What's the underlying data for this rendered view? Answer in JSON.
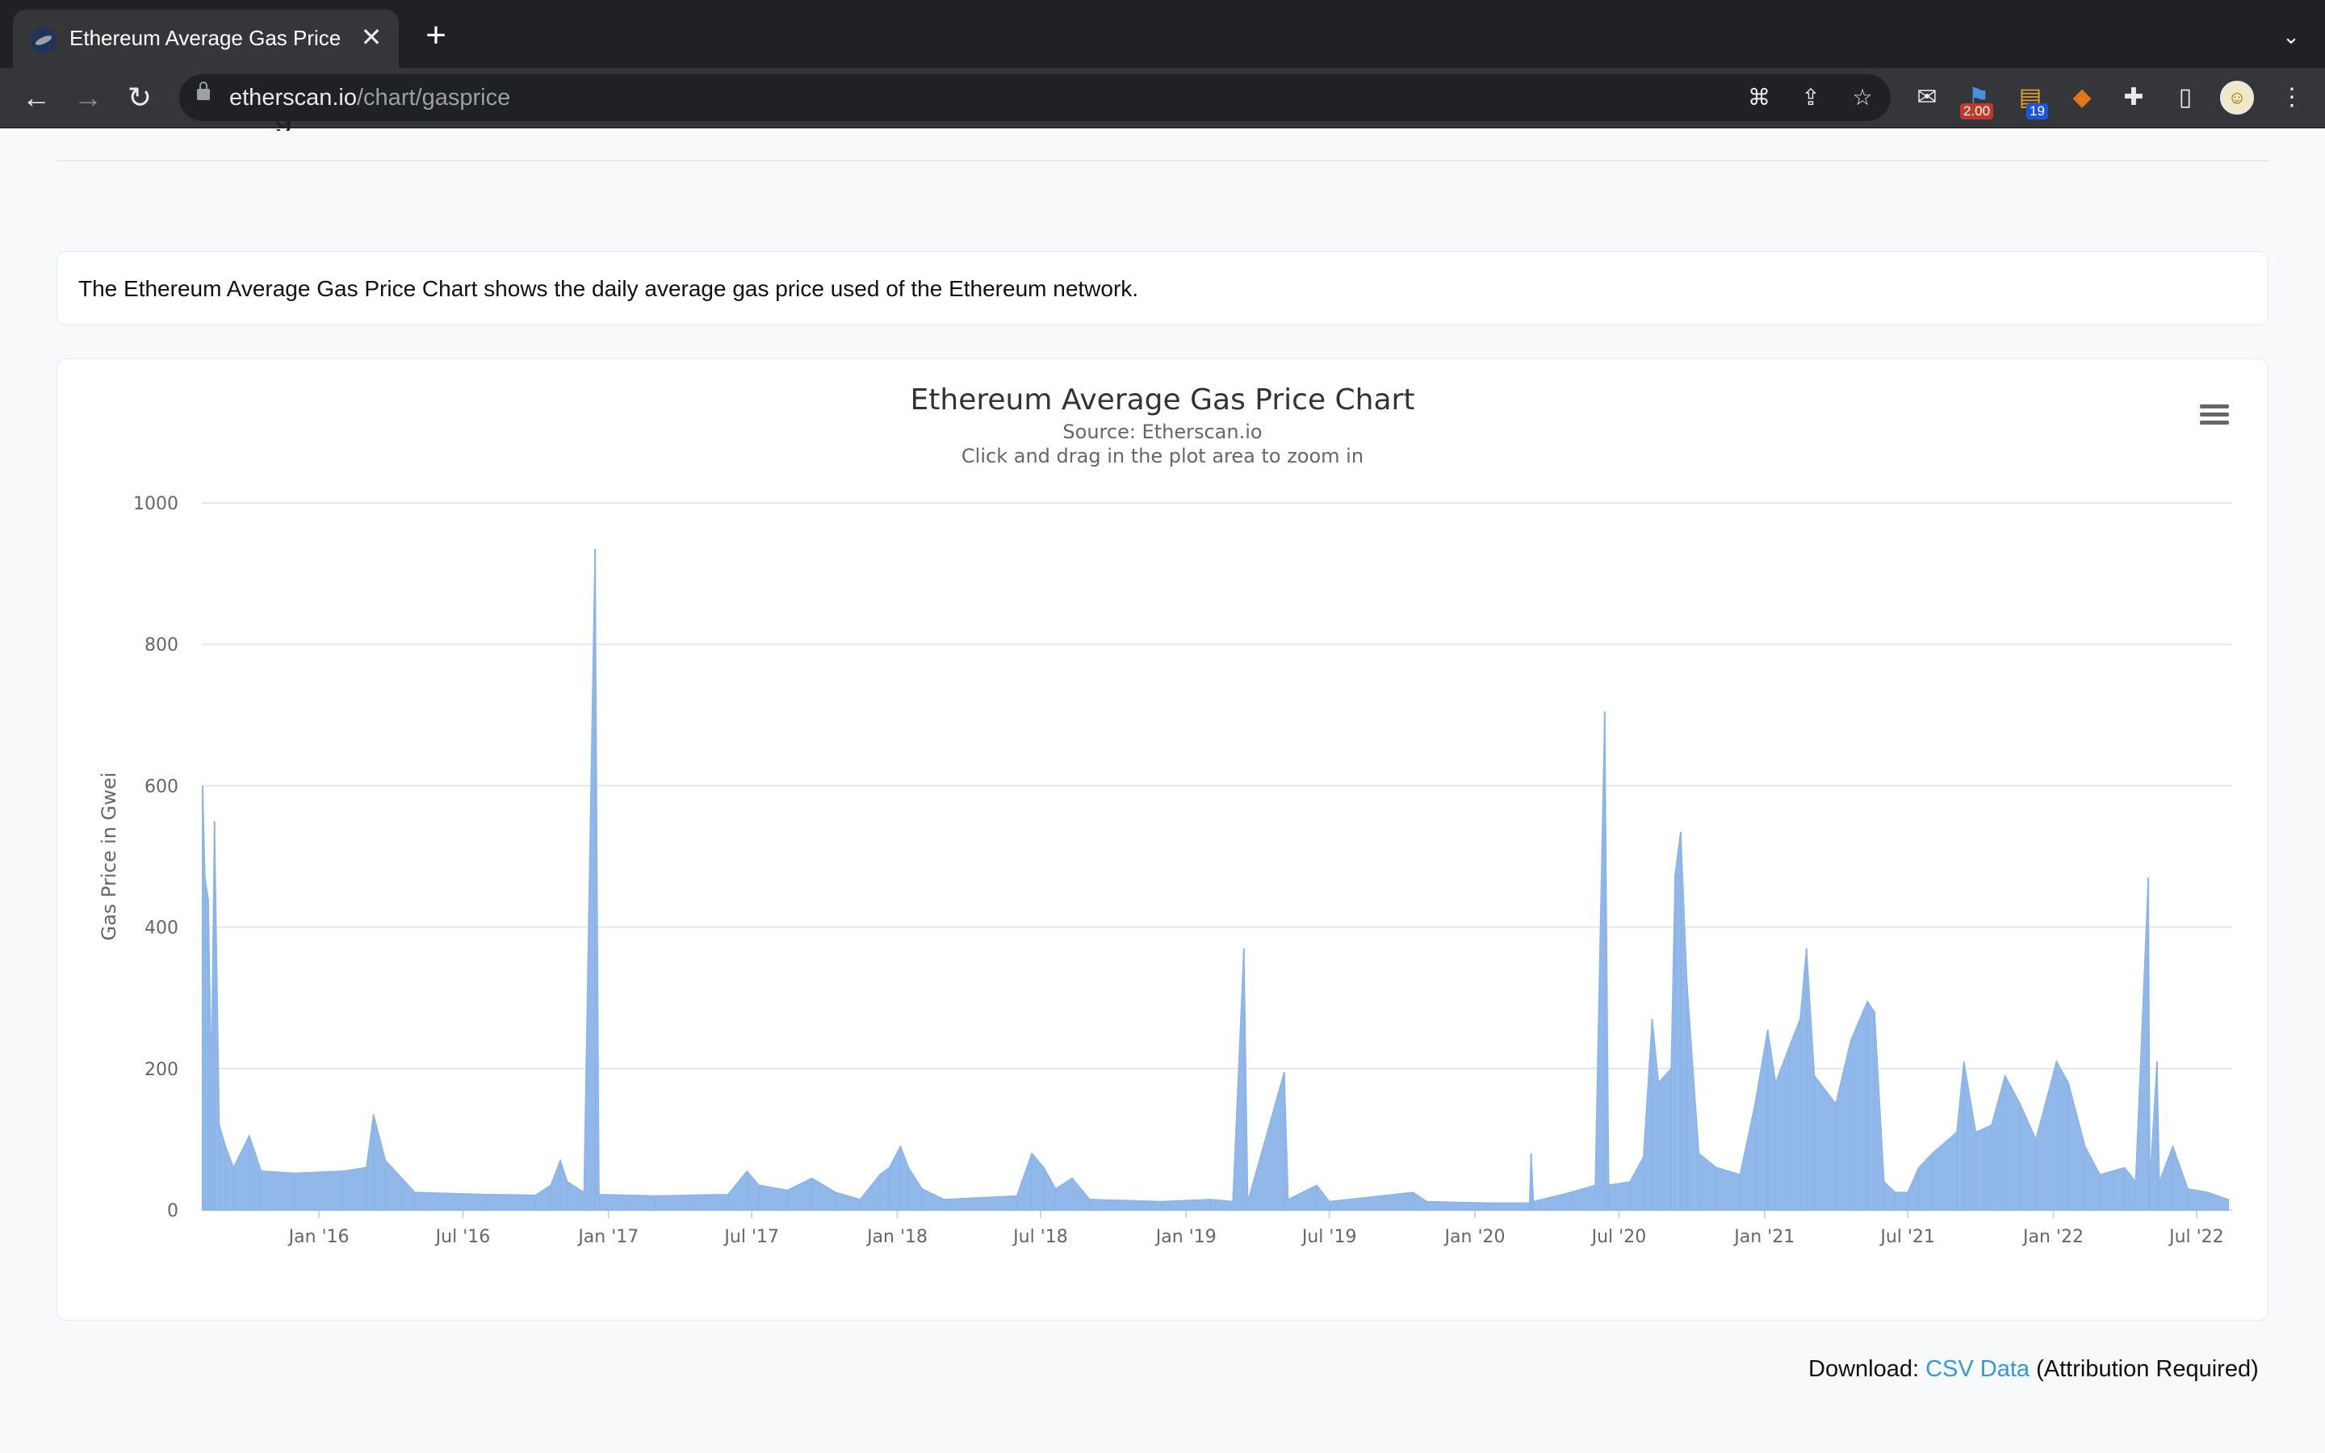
{
  "browser": {
    "tab_title": "Ethereum Average Gas Price Chart | Etherscan",
    "new_tab": "+",
    "url_domain": "etherscan.io",
    "url_path": "/chart/gasprice",
    "extensions": [
      {
        "name": "mail-extension-icon",
        "badge": ""
      },
      {
        "name": "flag-extension-icon",
        "badge": "2.00",
        "badge_color": "#c0392b"
      },
      {
        "name": "rss-extension-icon",
        "badge": "19",
        "badge_color": "#1a56db"
      },
      {
        "name": "fox-wallet-extension-icon",
        "badge": ""
      }
    ]
  },
  "page": {
    "description": "The Ethereum Average Gas Price Chart shows the daily average gas price used of the Ethereum network.",
    "download_prefix": "Download: ",
    "download_link": "CSV Data",
    "download_suffix": " (Attribution Required)"
  },
  "chart_data": {
    "type": "area",
    "title": "Ethereum Average Gas Price Chart",
    "subtitle": "Source: Etherscan.io",
    "subtitle2": "Click and drag in the plot area to zoom in",
    "ylabel": "Gas Price in Gwei",
    "xlabel": "",
    "ylim": [
      0,
      1000
    ],
    "yticks": [
      0,
      200,
      400,
      600,
      800,
      1000
    ],
    "xlim": [
      "2015-08-07",
      "2022-08-15"
    ],
    "xticks": [
      {
        "date": "2016-01-01",
        "label": "Jan '16"
      },
      {
        "date": "2016-07-01",
        "label": "Jul '16"
      },
      {
        "date": "2017-01-01",
        "label": "Jan '17"
      },
      {
        "date": "2017-07-01",
        "label": "Jul '17"
      },
      {
        "date": "2018-01-01",
        "label": "Jan '18"
      },
      {
        "date": "2018-07-01",
        "label": "Jul '18"
      },
      {
        "date": "2019-01-01",
        "label": "Jan '19"
      },
      {
        "date": "2019-07-01",
        "label": "Jul '19"
      },
      {
        "date": "2020-01-01",
        "label": "Jan '20"
      },
      {
        "date": "2020-07-01",
        "label": "Jul '20"
      },
      {
        "date": "2021-01-01",
        "label": "Jan '21"
      },
      {
        "date": "2021-07-01",
        "label": "Jul '21"
      },
      {
        "date": "2022-01-01",
        "label": "Jan '22"
      },
      {
        "date": "2022-07-01",
        "label": "Jul '22"
      }
    ],
    "grid": true,
    "series_color": "#8bb4e7",
    "series": [
      {
        "points": [
          [
            "2015-08-07",
            600
          ],
          [
            "2015-08-10",
            470
          ],
          [
            "2015-08-14",
            440
          ],
          [
            "2015-08-18",
            190
          ],
          [
            "2015-08-22",
            550
          ],
          [
            "2015-08-28",
            120
          ],
          [
            "2015-09-05",
            90
          ],
          [
            "2015-09-15",
            60
          ],
          [
            "2015-10-05",
            105
          ],
          [
            "2015-10-20",
            55
          ],
          [
            "2015-12-01",
            52
          ],
          [
            "2016-02-01",
            55
          ],
          [
            "2016-03-01",
            60
          ],
          [
            "2016-03-10",
            135
          ],
          [
            "2016-03-25",
            70
          ],
          [
            "2016-04-15",
            45
          ],
          [
            "2016-05-01",
            25
          ],
          [
            "2016-08-01",
            22
          ],
          [
            "2016-10-01",
            21
          ],
          [
            "2016-10-20",
            35
          ],
          [
            "2016-11-01",
            70
          ],
          [
            "2016-11-10",
            40
          ],
          [
            "2016-12-01",
            25
          ],
          [
            "2016-12-15",
            935
          ],
          [
            "2016-12-20",
            22
          ],
          [
            "2017-03-01",
            20
          ],
          [
            "2017-06-01",
            22
          ],
          [
            "2017-06-25",
            55
          ],
          [
            "2017-07-10",
            35
          ],
          [
            "2017-08-15",
            28
          ],
          [
            "2017-09-15",
            45
          ],
          [
            "2017-10-15",
            25
          ],
          [
            "2017-11-15",
            15
          ],
          [
            "2017-12-10",
            50
          ],
          [
            "2017-12-22",
            60
          ],
          [
            "2018-01-05",
            90
          ],
          [
            "2018-01-15",
            60
          ],
          [
            "2018-02-01",
            30
          ],
          [
            "2018-03-01",
            15
          ],
          [
            "2018-06-01",
            20
          ],
          [
            "2018-06-20",
            80
          ],
          [
            "2018-07-05",
            60
          ],
          [
            "2018-07-20",
            30
          ],
          [
            "2018-08-10",
            45
          ],
          [
            "2018-09-01",
            15
          ],
          [
            "2018-12-01",
            12
          ],
          [
            "2019-02-01",
            15
          ],
          [
            "2019-03-01",
            12
          ],
          [
            "2019-03-15",
            370
          ],
          [
            "2019-03-20",
            12
          ],
          [
            "2019-05-05",
            195
          ],
          [
            "2019-05-10",
            15
          ],
          [
            "2019-06-15",
            35
          ],
          [
            "2019-07-01",
            12
          ],
          [
            "2019-10-15",
            25
          ],
          [
            "2019-11-01",
            12
          ],
          [
            "2020-01-15",
            10
          ],
          [
            "2020-03-10",
            10
          ],
          [
            "2020-03-12",
            80
          ],
          [
            "2020-03-15",
            12
          ],
          [
            "2020-05-01",
            25
          ],
          [
            "2020-06-01",
            35
          ],
          [
            "2020-06-13",
            705
          ],
          [
            "2020-06-18",
            35
          ],
          [
            "2020-07-15",
            40
          ],
          [
            "2020-08-01",
            75
          ],
          [
            "2020-08-12",
            270
          ],
          [
            "2020-08-20",
            180
          ],
          [
            "2020-09-05",
            200
          ],
          [
            "2020-09-10",
            475
          ],
          [
            "2020-09-17",
            535
          ],
          [
            "2020-09-25",
            320
          ],
          [
            "2020-10-10",
            80
          ],
          [
            "2020-11-01",
            60
          ],
          [
            "2020-12-01",
            50
          ],
          [
            "2020-12-20",
            150
          ],
          [
            "2021-01-05",
            255
          ],
          [
            "2021-01-15",
            180
          ],
          [
            "2021-02-01",
            230
          ],
          [
            "2021-02-15",
            270
          ],
          [
            "2021-02-23",
            370
          ],
          [
            "2021-03-05",
            190
          ],
          [
            "2021-04-01",
            150
          ],
          [
            "2021-04-20",
            240
          ],
          [
            "2021-05-11",
            295
          ],
          [
            "2021-05-20",
            280
          ],
          [
            "2021-06-01",
            40
          ],
          [
            "2021-06-15",
            25
          ],
          [
            "2021-07-01",
            25
          ],
          [
            "2021-07-15",
            60
          ],
          [
            "2021-08-01",
            80
          ],
          [
            "2021-09-01",
            110
          ],
          [
            "2021-09-10",
            210
          ],
          [
            "2021-09-25",
            110
          ],
          [
            "2021-10-15",
            120
          ],
          [
            "2021-11-01",
            190
          ],
          [
            "2021-11-20",
            150
          ],
          [
            "2021-12-10",
            100
          ],
          [
            "2022-01-05",
            210
          ],
          [
            "2022-01-20",
            180
          ],
          [
            "2022-02-10",
            90
          ],
          [
            "2022-03-01",
            50
          ],
          [
            "2022-04-01",
            60
          ],
          [
            "2022-04-15",
            40
          ],
          [
            "2022-05-01",
            470
          ],
          [
            "2022-05-03",
            40
          ],
          [
            "2022-05-12",
            210
          ],
          [
            "2022-05-15",
            40
          ],
          [
            "2022-06-01",
            90
          ],
          [
            "2022-06-20",
            30
          ],
          [
            "2022-07-15",
            25
          ],
          [
            "2022-08-10",
            15
          ]
        ]
      }
    ]
  }
}
